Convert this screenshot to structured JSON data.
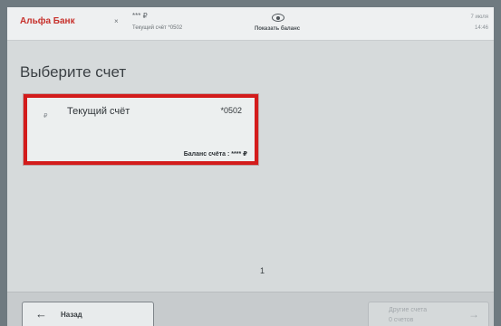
{
  "header": {
    "logo": "Альфа Банк",
    "close_symbol": "×",
    "account_mask": "*** ₽",
    "account_name": "Текущий счёт *0502",
    "eye_icon": "eye-icon",
    "show_balance": "Показать баланс",
    "date": "7 июля",
    "time": "14:46"
  },
  "main": {
    "title": "Выберите счет",
    "accounts": [
      {
        "currency": "₽",
        "label": "Текущий счёт",
        "number": "*0502",
        "balance": "Баланс счёта : **** ₽"
      }
    ],
    "page_number": "1"
  },
  "footer": {
    "back_arrow": "←",
    "back_label": "Назад",
    "other_line1": "Другие счета",
    "other_line2": "0 счетов",
    "other_arrow": "→"
  },
  "colors": {
    "brand": "#c7302b",
    "highlight": "#d31b1b"
  }
}
